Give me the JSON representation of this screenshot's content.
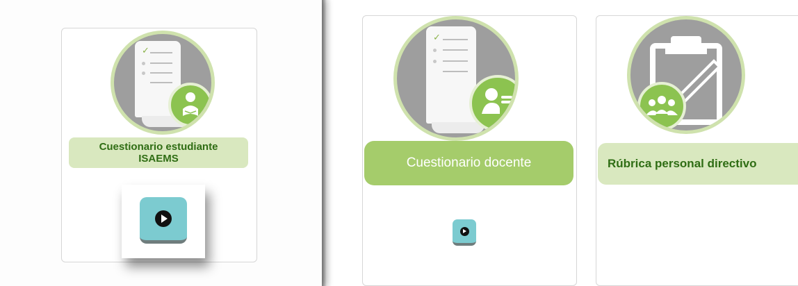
{
  "cards": [
    {
      "title": "Cuestionario estudiante ISAEMS",
      "title_line1": "Cuestionario estudiante",
      "title_line2": "ISAEMS"
    },
    {
      "title": "Cuestionario docente"
    },
    {
      "title": "Rúbrica personal directivo"
    }
  ],
  "icons": {
    "card1": "document-student-reading-icon",
    "card2": "document-teacher-icon",
    "card3": "clipboard-group-icon",
    "play": "play-icon"
  },
  "colors": {
    "label_bg": "#d9e8bf",
    "label_bg_strong": "#a5cc6b",
    "label_text": "#2f6d14",
    "circle_ring": "#cfe2ad",
    "circle_fill": "#9e9e9e",
    "badge_green": "#8cc350",
    "play_bg": "#7ccbd0"
  }
}
